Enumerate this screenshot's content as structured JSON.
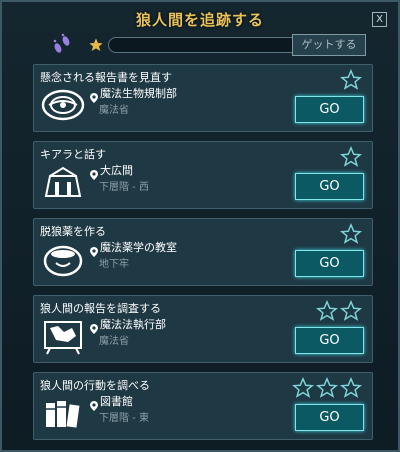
{
  "window": {
    "title": "狼人間を追跡する",
    "close_label": "X"
  },
  "progress": {
    "get_label": "ゲットする",
    "fill_fraction": 0
  },
  "quests": [
    {
      "title": "懸念される報告書を見直す",
      "location": "魔法生物規制部",
      "sublocation": "魔法省",
      "stars": 1,
      "go_label": "GO",
      "icon": "ministry-seal-icon"
    },
    {
      "title": "キアラと話す",
      "location": "大広間",
      "sublocation": "下層階 - 西",
      "stars": 1,
      "go_label": "GO",
      "icon": "great-hall-icon"
    },
    {
      "title": "脱狼薬を作る",
      "location": "魔法薬学の教室",
      "sublocation": "地下牢",
      "stars": 1,
      "go_label": "GO",
      "icon": "cauldron-icon"
    },
    {
      "title": "狼人間の報告を調査する",
      "location": "魔法法執行部",
      "sublocation": "魔法省",
      "stars": 2,
      "go_label": "GO",
      "icon": "map-board-icon"
    },
    {
      "title": "狼人間の行動を調べる",
      "location": "図書館",
      "sublocation": "下層階 - 東",
      "stars": 3,
      "go_label": "GO",
      "icon": "books-icon"
    }
  ],
  "colors": {
    "title": "#e7c35a",
    "go_button": "#0b5a63",
    "go_border": "#7fe6ec",
    "star_outline": "#7fd3d8"
  }
}
